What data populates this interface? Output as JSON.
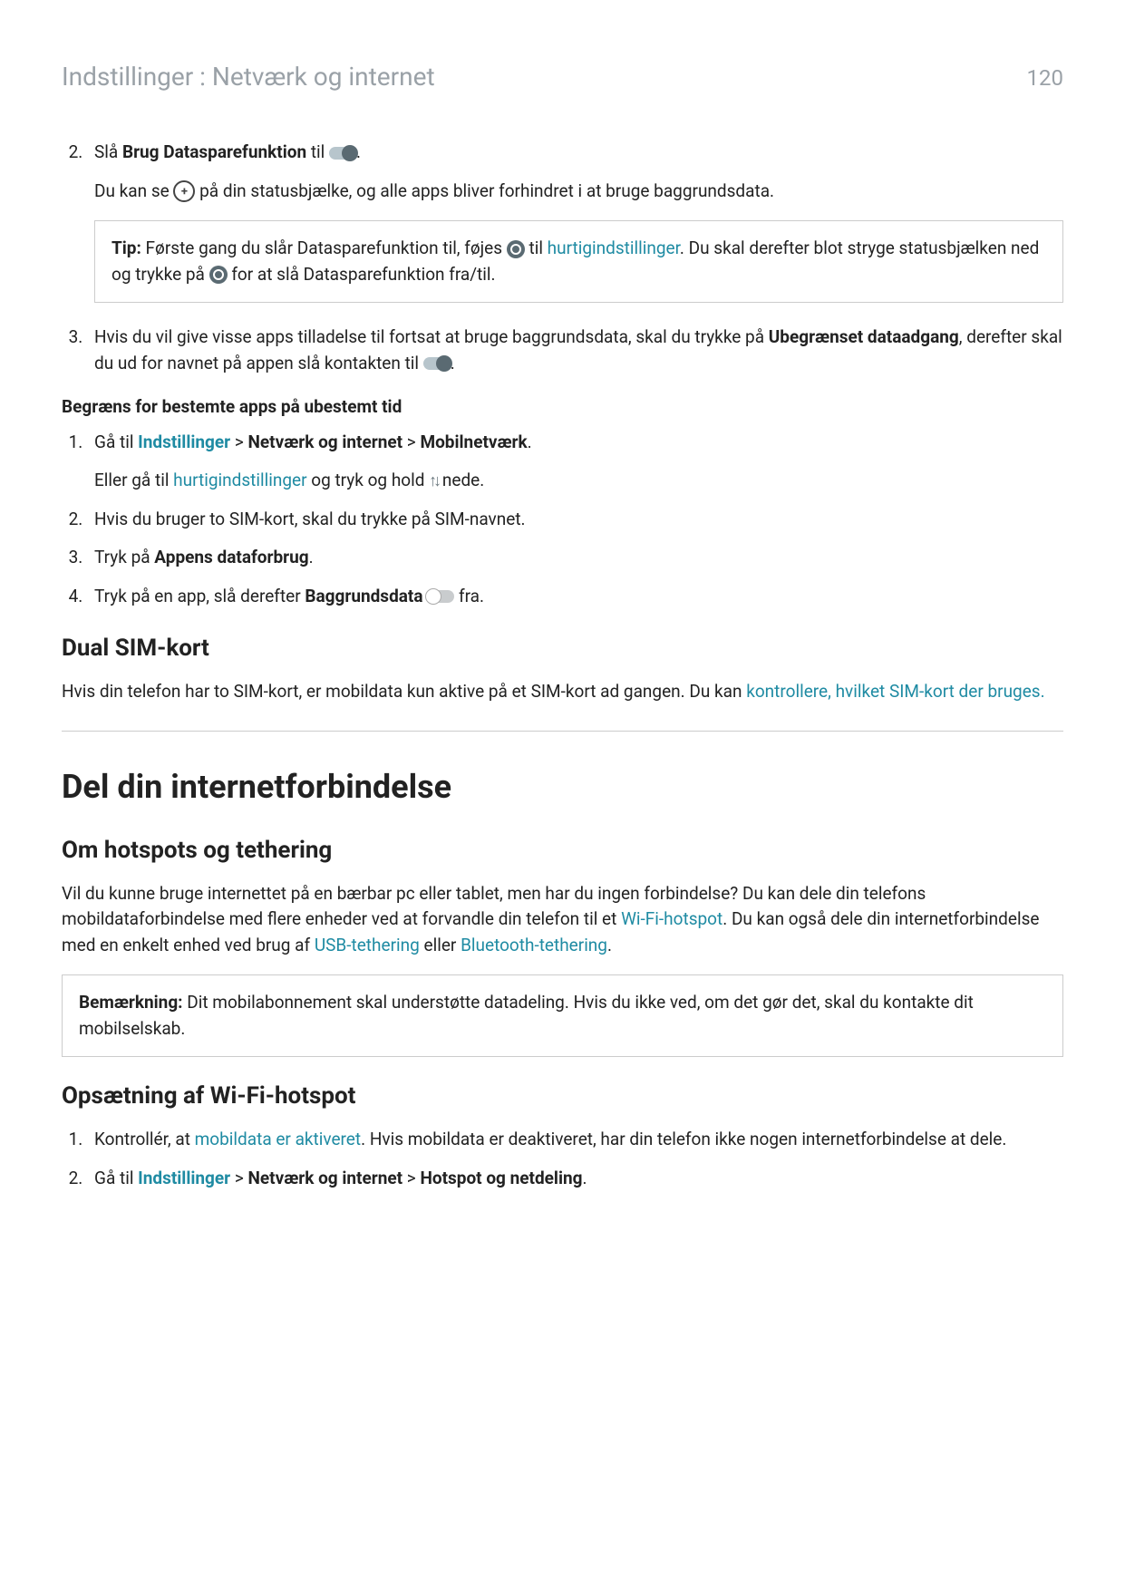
{
  "header": {
    "title": "Indstillinger : Netværk og internet",
    "page_number": "120"
  },
  "step2": {
    "pre": "Slå ",
    "bold": "Brug Datasparefunktion",
    "post": " til ",
    "para_pre": "Du kan se ",
    "para_post": " på din statusbjælke, og alle apps bliver forhindret i at bruge baggrundsdata."
  },
  "tip": {
    "label": "Tip:",
    "t1": " Første gang du slår Datasparefunktion til, føjes ",
    "t2": " til ",
    "link": "hurtigindstillinger",
    "t3": ". Du skal derefter blot stryge statusbjælken ned og trykke på ",
    "t4": " for at slå Datasparefunktion fra/til."
  },
  "step3": {
    "t1": "Hvis du vil give visse apps tilladelse til fortsat at bruge baggrundsdata, skal du trykke på ",
    "b1": "Ubegrænset dataadgang",
    "t2": ", derefter skal du ud for navnet på appen slå kontakten til "
  },
  "restrict_heading": "Begræns for bestemte apps på ubestemt tid",
  "r1": {
    "pre": "Gå til ",
    "link": "Indstillinger",
    "sep": " > ",
    "b1": "Netværk og internet",
    "b2": "Mobilnetværk",
    "post": ".",
    "alt_pre": "Eller gå til ",
    "alt_link": "hurtigindstillinger",
    "alt_mid": " og tryk og hold ",
    "alt_post": " nede."
  },
  "r2": "Hvis du bruger to SIM-kort, skal du trykke på SIM-navnet.",
  "r3": {
    "pre": "Tryk på ",
    "b": "Appens dataforbrug",
    "post": "."
  },
  "r4": {
    "pre": "Tryk på en app, slå derefter ",
    "b": "Baggrundsdata",
    "post": " fra."
  },
  "dual_sim": {
    "heading": "Dual SIM-kort",
    "text": "Hvis din telefon har to SIM-kort, er mobildata kun aktive på et SIM-kort ad gangen. Du kan ",
    "link": "kontrollere, hvilket SIM-kort der bruges."
  },
  "share": {
    "heading": "Del din internetforbindelse",
    "about_heading": "Om hotspots og tethering",
    "about_p1a": "Vil du kunne bruge internettet på en bærbar pc eller tablet, men har du ingen forbindelse? Du kan dele din telefons mobildataforbindelse med flere enheder ved at forvandle din telefon til et ",
    "about_link1": "Wi-Fi-hotspot",
    "about_p1b": ". Du kan også dele din internetforbindelse med en enkelt enhed ved brug af ",
    "about_link2": "USB-tethering",
    "about_or": " eller ",
    "about_link3": "Bluetooth-tethering",
    "about_end": "."
  },
  "note": {
    "label": "Bemærkning:",
    "text": " Dit mobilabonnement skal understøtte datadeling. Hvis du ikke ved, om det gør det, skal du kontakte dit mobilselskab."
  },
  "setup": {
    "heading": "Opsætning af Wi-Fi-hotspot",
    "s1_pre": "Kontrollér, at ",
    "s1_link": "mobildata er aktiveret",
    "s1_post": ". Hvis mobildata er deaktiveret, har din telefon ikke nogen internetforbindelse at dele.",
    "s2_pre": "Gå til ",
    "s2_link": "Indstillinger",
    "sep": " > ",
    "s2_b1": "Netværk og internet",
    "s2_b2": "Hotspot og netdeling",
    "s2_post": "."
  }
}
